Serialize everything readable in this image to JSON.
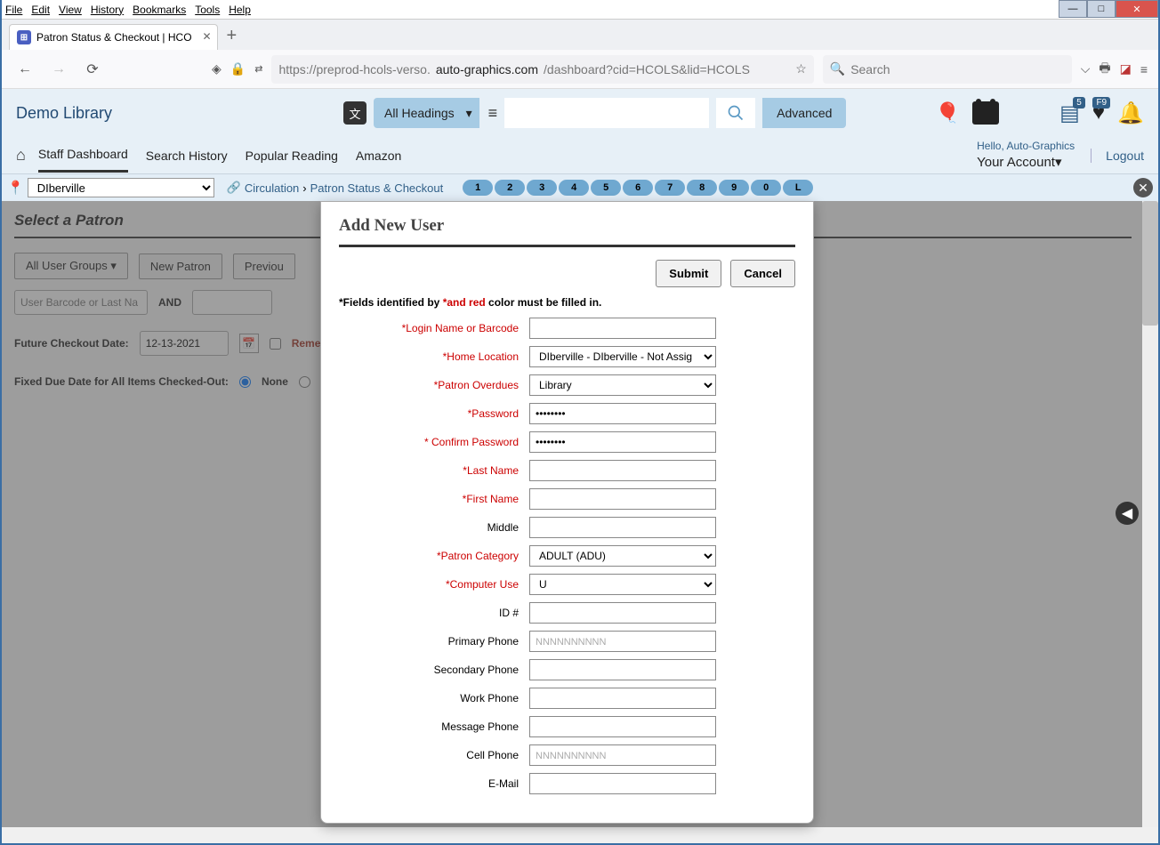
{
  "menu": {
    "file": "File",
    "edit": "Edit",
    "view": "View",
    "history": "History",
    "bookmarks": "Bookmarks",
    "tools": "Tools",
    "help": "Help"
  },
  "tab": {
    "title": "Patron Status & Checkout | HCO"
  },
  "url": {
    "prefix": "https://preprod-hcols-verso.",
    "domain": "auto-graphics.com",
    "suffix": "/dashboard?cid=HCOLS&lid=HCOLS"
  },
  "search_placeholder": "Search",
  "brand": "Demo Library",
  "headings_select": "All Headings",
  "advanced": "Advanced",
  "badge5": "5",
  "badgeF9": "F9",
  "nav": {
    "staff": "Staff Dashboard",
    "history": "Search History",
    "popular": "Popular Reading",
    "amazon": "Amazon"
  },
  "hello": "Hello, Auto-Graphics",
  "your_account": "Your Account",
  "logout": "Logout",
  "location": "DIberville",
  "crumb1": "Circulation",
  "crumb2": "Patron Status & Checkout",
  "pills": [
    "1",
    "2",
    "3",
    "4",
    "5",
    "6",
    "7",
    "8",
    "9",
    "0",
    "L"
  ],
  "bg": {
    "title": "Select a Patron",
    "allgroups": "All User Groups",
    "newpatron": "New Patron",
    "prev": "Previou",
    "barcode_ph": "User Barcode or Last Na",
    "and": "AND",
    "future": "Future Checkout Date:",
    "date": "12-13-2021",
    "remember": "Remem",
    "fixed": "Fixed Due Date for All Items Checked-Out:",
    "none": "None"
  },
  "modal": {
    "title": "Add New User",
    "submit": "Submit",
    "cancel": "Cancel",
    "note_prefix": "*Fields identified by ",
    "note_star": "*and red",
    "note_suffix": " color must be filled in.",
    "labels": {
      "login": "*Login Name or Barcode",
      "home": "*Home Location",
      "overdues": "*Patron Overdues",
      "password": "*Password",
      "confirm": "* Confirm Password",
      "last": "*Last Name",
      "first": "*First Name",
      "middle": "Middle",
      "category": "*Patron Category",
      "computer": "*Computer Use",
      "id": "ID #",
      "pphone": "Primary Phone",
      "sphone": "Secondary Phone",
      "wphone": "Work Phone",
      "mphone": "Message Phone",
      "cphone": "Cell Phone",
      "email": "E-Mail"
    },
    "values": {
      "home": "DIberville - DIberville - Not Assig",
      "overdues": "Library",
      "password": "••••••••",
      "confirm": "••••••••",
      "category": "ADULT (ADU)",
      "computer": "U",
      "phone_ph": "NNNNNNNNNN"
    }
  }
}
